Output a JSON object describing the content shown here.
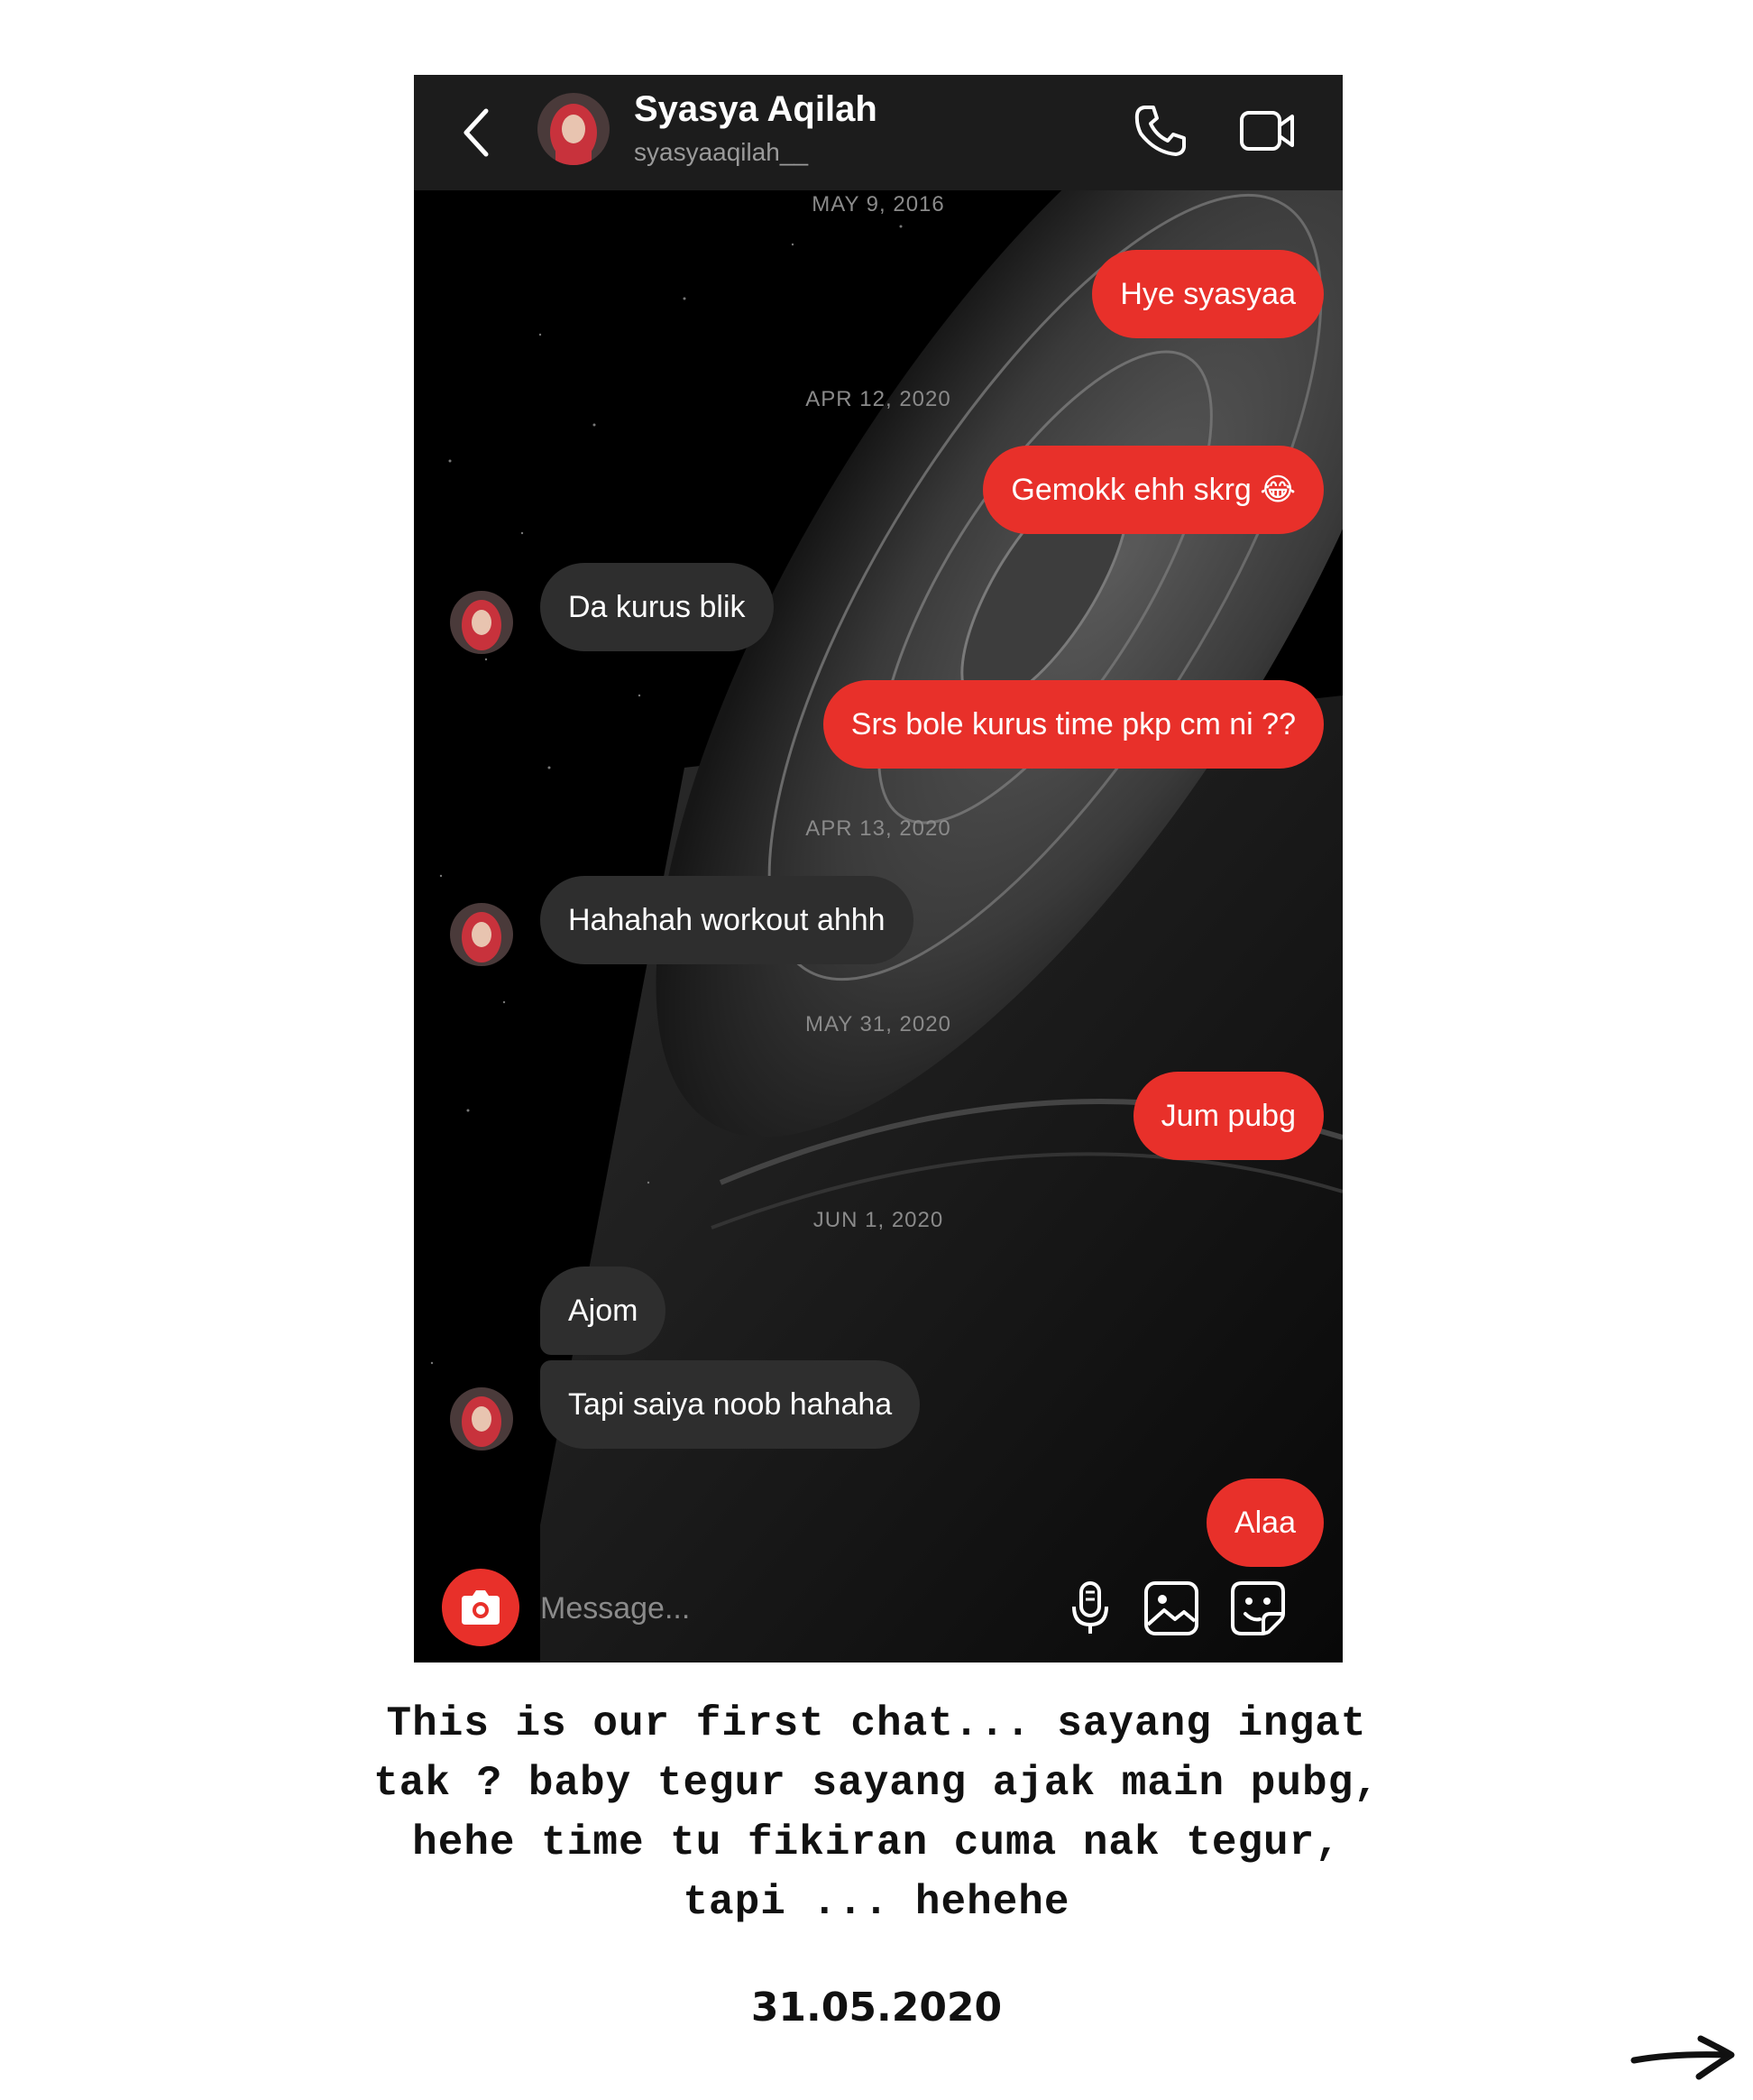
{
  "header": {
    "name": "Syasya Aqilah",
    "username": "syasyaaqilah__"
  },
  "conversation": [
    {
      "type": "date",
      "text": "MAY 9, 2016"
    },
    {
      "type": "sent",
      "text": "Hye syasyaa"
    },
    {
      "type": "date",
      "text": "APR 12, 2020"
    },
    {
      "type": "sent",
      "text": "Gemokk ehh skrg 😂"
    },
    {
      "type": "received",
      "text": "Da kurus blik"
    },
    {
      "type": "sent",
      "text": "Srs bole kurus time pkp cm ni ??"
    },
    {
      "type": "date",
      "text": "APR 13, 2020"
    },
    {
      "type": "received",
      "text": "Hahahah workout ahhh"
    },
    {
      "type": "date",
      "text": "MAY 31, 2020"
    },
    {
      "type": "sent",
      "text": "Jum pubg"
    },
    {
      "type": "date",
      "text": "JUN 1, 2020"
    },
    {
      "type": "received",
      "text": "Ajom"
    },
    {
      "type": "received",
      "text": "Tapi saiya noob hahaha"
    },
    {
      "type": "sent",
      "text": "Alaa"
    }
  ],
  "composer": {
    "placeholder": "Message..."
  },
  "caption": {
    "line1": "This is our first chat... sayang ingat",
    "line2": "tak ? baby tegur sayang ajak main pubg,",
    "line3": "hehe time tu fikiran cuma nak tegur,",
    "line4": "tapi ... hehehe"
  },
  "date_stamp": "31.05.2020",
  "icons": {
    "back": "chevron-left-icon",
    "call": "phone-icon",
    "video": "video-camera-icon",
    "camera": "camera-icon",
    "mic": "microphone-icon",
    "gallery": "image-icon",
    "sticker": "sticker-icon",
    "next": "arrow-right-icon"
  },
  "colors": {
    "sent_bubble": "#e8302a",
    "received_bubble": "#2e2e2e",
    "header_bg": "#1c1c1c",
    "chat_bg": "#000000"
  }
}
